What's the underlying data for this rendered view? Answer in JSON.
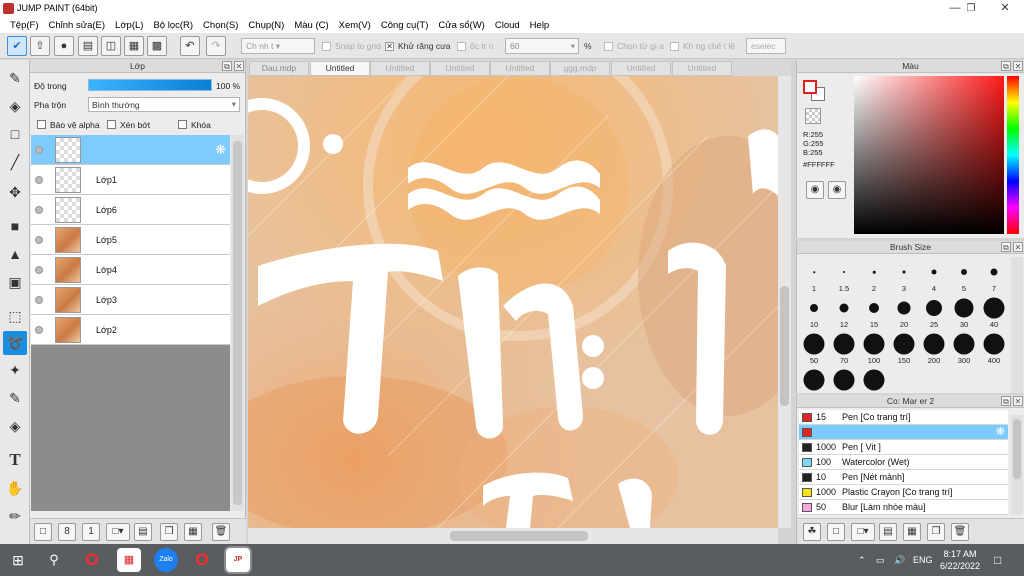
{
  "window": {
    "title": "JUMP PAINT (64bit)"
  },
  "menu": [
    "Tệp(F)",
    "Chỉnh sửa(E)",
    "Lớp(L)",
    "Bộ lọc(R)",
    "Chọn(S)",
    "Chụp(N)",
    "Màu (C)",
    "Xem(V)",
    "Công cụ(T)",
    "Cửa sổ(W)",
    "Cloud",
    "Help"
  ],
  "toolbar": {
    "select_field": "Ch   nh   t",
    "snap_label": "Snap to grid",
    "antialias_label": "Khử răng cưa",
    "tol_label": "ốc tr   n",
    "tol_value": "60",
    "percent": "%",
    "chon_label": "Chọn từ gi   a",
    "khong_label": "Kh   ng chế t   lệ",
    "deselect_label": "eselec"
  },
  "layer_panel": {
    "title": "Lớp",
    "opacity_label": "Độ trong",
    "opacity_value": "100 %",
    "blend_label": "Pha trộn",
    "blend_value": "Bình thường",
    "protect_alpha": "Bảo vệ alpha",
    "clip": "Xén bớt",
    "lock": "Khóa",
    "layers": [
      {
        "name": "",
        "selected": true,
        "image": false
      },
      {
        "name": "Lớp1",
        "selected": false,
        "image": false
      },
      {
        "name": "Lớp6",
        "selected": false,
        "image": false
      },
      {
        "name": "Lớp5",
        "selected": false,
        "image": true
      },
      {
        "name": "Lớp4",
        "selected": false,
        "image": true
      },
      {
        "name": "Lớp3",
        "selected": false,
        "image": true
      },
      {
        "name": "Lớp2",
        "selected": false,
        "image": true
      }
    ]
  },
  "doc_tabs": [
    "Dau.mdp",
    "Untitled",
    "Untitled",
    "Untitled",
    "Untitled",
    "ggg.mdp",
    "Untitled",
    "Untitled"
  ],
  "doc_tabs_active": 1,
  "color_panel": {
    "title": "Màu",
    "r": "R:255",
    "g": "G:255",
    "b": "B:255",
    "hex": "#FFFFFF",
    "foreground": "#e02020",
    "background": "#ffffff"
  },
  "brush_panel": {
    "title": "Brush Size",
    "sizes": [
      "1",
      "1.5",
      "2",
      "3",
      "4",
      "5",
      "7",
      "10",
      "12",
      "15",
      "20",
      "25",
      "30",
      "40",
      "50",
      "70",
      "100",
      "150",
      "200",
      "300",
      "400",
      "",
      "",
      ""
    ]
  },
  "pen_panel": {
    "title": "Co: Mar   er 2",
    "items": [
      {
        "size": "15",
        "name": "Pen [Co trang trí]",
        "color": "#e02525",
        "selected": false
      },
      {
        "size": "",
        "name": "",
        "color": "#e02525",
        "selected": true
      },
      {
        "size": "1000",
        "name": "Pen [ Vit ]",
        "color": "#222222",
        "selected": false
      },
      {
        "size": "100",
        "name": "Watercolor (Wet)",
        "color": "#7fd6f5",
        "selected": false
      },
      {
        "size": "10",
        "name": "Pen [Nét mảnh]",
        "color": "#222222",
        "selected": false
      },
      {
        "size": "1000",
        "name": "Plastic Crayon [Co trang trí]",
        "color": "#f2e21a",
        "selected": false
      },
      {
        "size": "50",
        "name": "Blur [Làm nhòe màu]",
        "color": "#f4a8d8",
        "selected": false
      }
    ]
  },
  "taskbar": {
    "lang": "ENG",
    "time": "8:17 AM",
    "date": "6/22/2022"
  }
}
